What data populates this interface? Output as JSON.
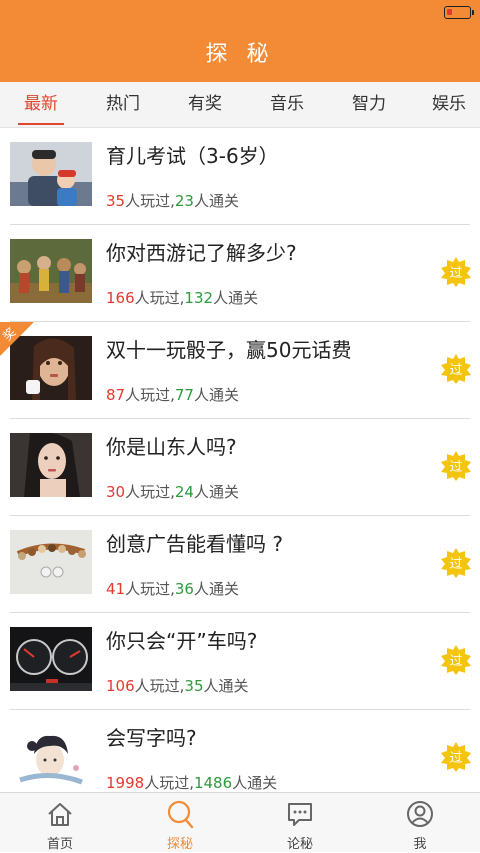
{
  "header": {
    "title": "探 秘"
  },
  "tabs": [
    {
      "label": "最新",
      "active": true
    },
    {
      "label": "热门"
    },
    {
      "label": "有奖"
    },
    {
      "label": "音乐"
    },
    {
      "label": "智力"
    },
    {
      "label": "娱乐"
    }
  ],
  "items": [
    {
      "title": "育儿考试（3-6岁）",
      "played": "35",
      "played_suffix": "人玩过,",
      "passed": "23",
      "passed_suffix": "人通关",
      "passed_badge": false,
      "prize": false
    },
    {
      "title": "你对西游记了解多少?",
      "played": "166",
      "played_suffix": "人玩过,",
      "passed": "132",
      "passed_suffix": "人通关",
      "passed_badge": true,
      "badge_text": "过"
    },
    {
      "title": "双十一玩骰子，赢50元话费",
      "played": "87",
      "played_suffix": "人玩过,",
      "passed": "77",
      "passed_suffix": "人通关",
      "passed_badge": true,
      "badge_text": "过",
      "prize": true,
      "prize_text": "奖"
    },
    {
      "title": "你是山东人吗?",
      "played": "30",
      "played_suffix": "人玩过,",
      "passed": "24",
      "passed_suffix": "人通关",
      "passed_badge": true,
      "badge_text": "过"
    },
    {
      "title": "创意广告能看懂吗 ?",
      "played": "41",
      "played_suffix": "人玩过,",
      "passed": "36",
      "passed_suffix": "人通关",
      "passed_badge": true,
      "badge_text": "过"
    },
    {
      "title": "你只会“开”车吗?",
      "played": "106",
      "played_suffix": "人玩过,",
      "passed": "35",
      "passed_suffix": "人通关",
      "passed_badge": true,
      "badge_text": "过"
    },
    {
      "title": "会写字吗?",
      "played": "1998",
      "played_suffix": "人玩过,",
      "passed": "1486",
      "passed_suffix": "人通关",
      "passed_badge": true,
      "badge_text": "过"
    }
  ],
  "bottom_nav": [
    {
      "label": "首页",
      "icon": "home-icon"
    },
    {
      "label": "探秘",
      "icon": "search-icon",
      "active": true
    },
    {
      "label": "论秘",
      "icon": "chat-icon"
    },
    {
      "label": "我",
      "icon": "profile-icon"
    }
  ],
  "colors": {
    "accent": "#f28a36",
    "tab_active": "#e2462f",
    "played": "#e23b2e",
    "passed": "#2e9a3e",
    "badge": "#f5c40e"
  }
}
